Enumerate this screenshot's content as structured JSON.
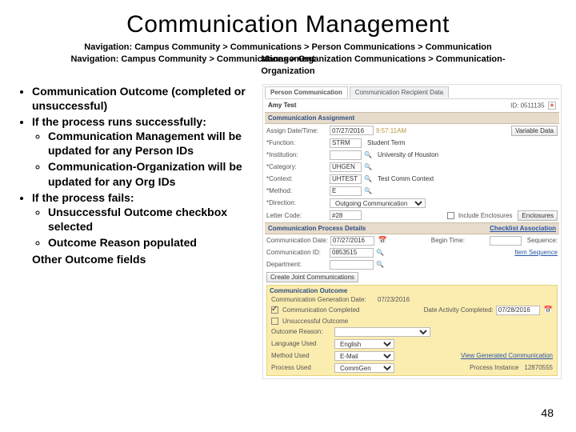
{
  "title": "Communication Management",
  "nav_line1": "Navigation: Campus Community > Communications > Person Communications > Communication",
  "nav_line2": "Navigation: Campus Community > Communications > Organization Communications > Communication-",
  "nav_line2_overlap": "Management",
  "nav_line3": "Organization",
  "bullets": {
    "b1": "Communication Outcome (completed or unsuccessful)",
    "b2": "If the process runs successfully:",
    "b2a": "Communication Management will be updated for any Person IDs",
    "b2b": "Communication-Organization will be updated for any Org IDs",
    "b3": "If the process fails:",
    "b3a": "Unsuccessful Outcome checkbox selected",
    "b3b": "Outcome Reason populated",
    "b3_tail": "Other Outcome fields"
  },
  "tabs": {
    "t1": "Person Communication",
    "t2": "Communication Recipient Data"
  },
  "hdr": {
    "name": "Amy Test",
    "id_lbl": "ID:",
    "id_val": "0511135"
  },
  "assign": {
    "hdr": "Communication Assignment",
    "var_data": "Variable Data",
    "date_lbl": "Assign Date/Time:",
    "date": "07/27/2016",
    "time": "9:57:11AM",
    "func_lbl": "*Function:",
    "func": "STRM",
    "func_disp": "Student Term",
    "inst_lbl": "*Institution:",
    "inst": "",
    "inst_disp": "University of Houston",
    "cat_lbl": "*Category:",
    "cat": "UHGEN",
    "ctx_lbl": "*Context:",
    "ctx": "UHTEST",
    "ctx_disp": "Test Comm Context",
    "meth_lbl": "*Method:",
    "meth": "E",
    "dir_lbl": "*Direction:",
    "dir": "Outgoing Communication",
    "letter_lbl": "Letter Code:",
    "letter": "#28",
    "include_enc": "Include Enclosures",
    "enc_btn": "Enclosures"
  },
  "proc": {
    "hdr": "Communication Process Details",
    "chk_assoc": "Checklist Association",
    "date_lbl": "Communication Date:",
    "date": "07/27/2016",
    "begin_lbl": "Begin Time:",
    "begin": "",
    "seq_lbl": "Sequence:",
    "seq": "",
    "item_seq": "Item Sequence",
    "id_lbl": "Communication ID:",
    "id": "0853515",
    "dept_lbl": "Department:",
    "dept": "",
    "joint_btn": "Create Joint Communications"
  },
  "outcome": {
    "hdr": "Communication Outcome",
    "gen_lbl": "Communication Generation Date:",
    "gen": "07/23/2016",
    "comp_lbl": "Communication Completed",
    "act_lbl": "Date Activity Completed:",
    "act": "07/28/2016",
    "unsucc_lbl": "Unsuccessful Outcome",
    "reason_lbl": "Outcome Reason:",
    "reason": "",
    "lang_lbl": "Language Used",
    "lang": "English",
    "meth_lbl": "Method Used",
    "meth": "E-Mail",
    "proc_lbl": "Process Used",
    "proc": "CommGen",
    "view_link": "View Generated Communication",
    "inst_lbl": "Process Instance",
    "inst": "12870555"
  },
  "page_num": "48"
}
